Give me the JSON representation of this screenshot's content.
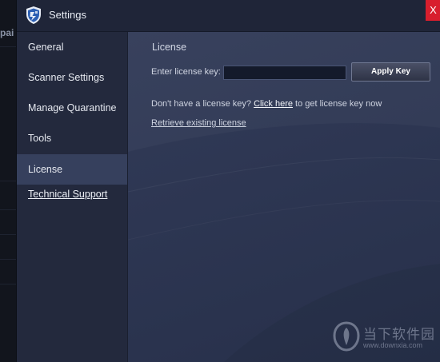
{
  "background_app": {
    "partial_text": "pai"
  },
  "dialog": {
    "title": "Settings",
    "close_label": "X"
  },
  "sidebar": {
    "items": [
      {
        "label": "General"
      },
      {
        "label": "Scanner Settings"
      },
      {
        "label": "Manage Quarantine"
      },
      {
        "label": "Tools"
      },
      {
        "label": "License",
        "active": true
      }
    ],
    "support_link": "Technical Support"
  },
  "license": {
    "section_title": "License",
    "key_label": "Enter license key:",
    "key_value": "",
    "apply_label": "Apply Key",
    "no_key_prefix": "Don't have a license key?",
    "click_here": "Click here",
    "no_key_suffix": "to get license key now",
    "retrieve_link": "Retrieve existing license"
  },
  "watermark": {
    "brand_cn": "当下软件园",
    "url": "www.downxia.com"
  },
  "colors": {
    "accent_close": "#d81e2d",
    "panel_bg": "#2b3450",
    "sidebar_bg": "#23293d",
    "active_item": "#36405d"
  },
  "icons": {
    "app_logo": "shield-logo-icon",
    "watermark_logo": "downxia-logo-icon"
  }
}
